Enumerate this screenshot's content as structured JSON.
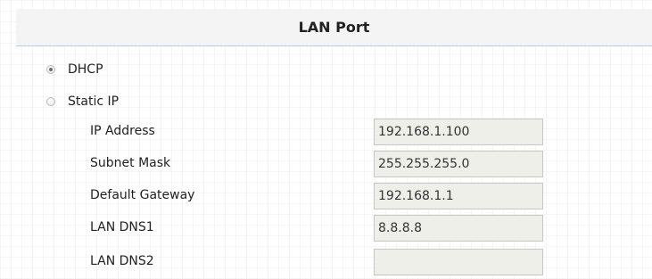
{
  "section": {
    "title": "LAN Port"
  },
  "mode": {
    "dhcp_label": "DHCP",
    "static_label": "Static IP",
    "selected": "DHCP"
  },
  "fields": [
    {
      "label": "IP Address",
      "value": "192.168.1.100"
    },
    {
      "label": "Subnet Mask",
      "value": "255.255.255.0"
    },
    {
      "label": "Default Gateway",
      "value": "192.168.1.1"
    },
    {
      "label": "LAN DNS1",
      "value": "8.8.8.8"
    },
    {
      "label": "LAN DNS2",
      "value": ""
    }
  ],
  "colors": {
    "header_background": "#f4f4f4",
    "header_border": "#b9cde3",
    "input_background": "#efefea",
    "input_border": "#c6c6c6"
  }
}
